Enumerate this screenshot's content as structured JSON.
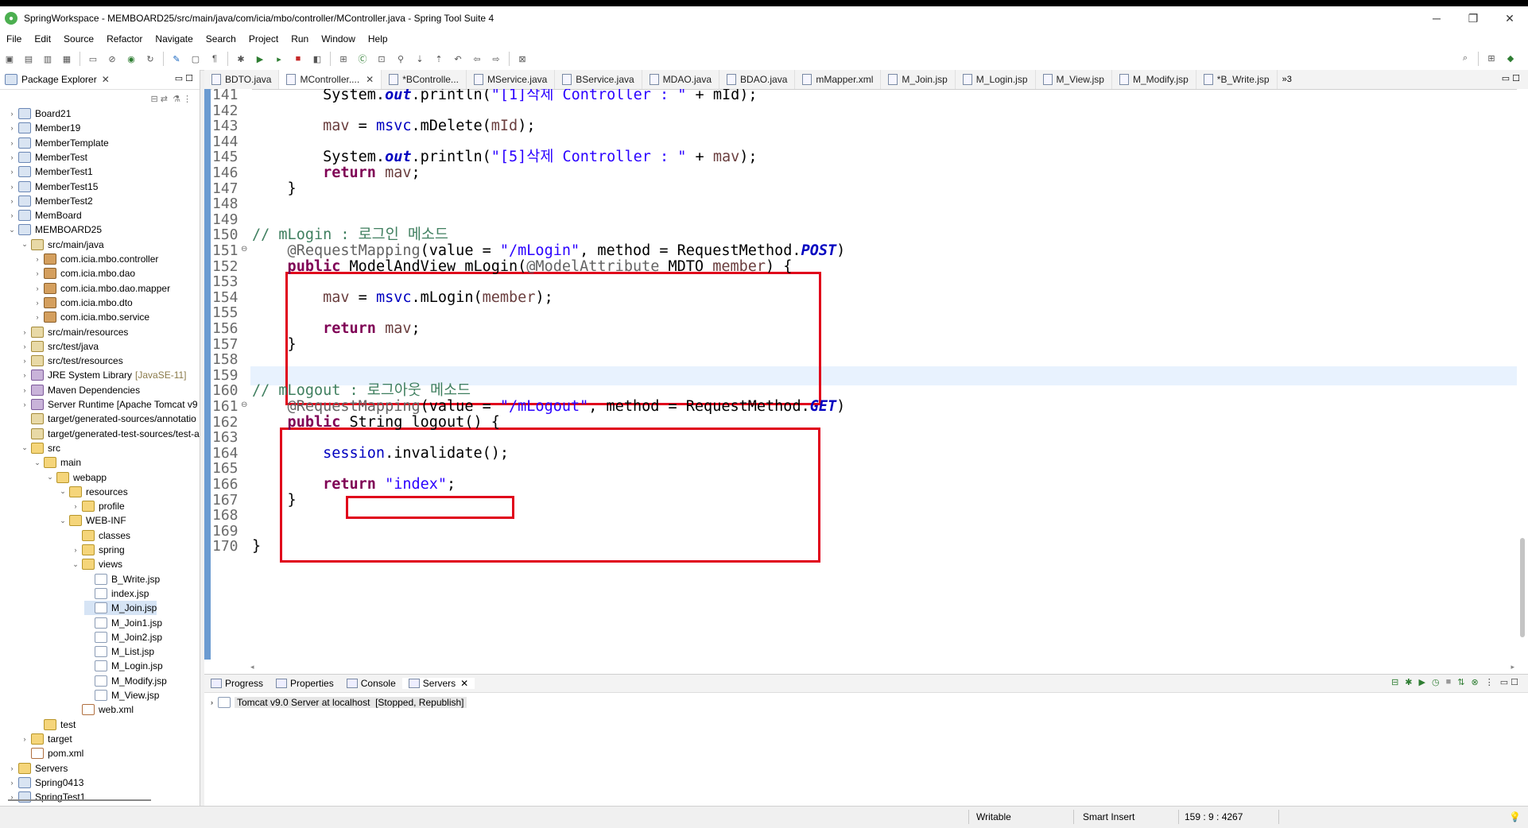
{
  "window": {
    "title": "SpringWorkspace - MEMBOARD25/src/main/java/com/icia/mbo/controller/MController.java - Spring Tool Suite 4",
    "controls": [
      "─",
      "❐",
      "✕"
    ]
  },
  "menu": [
    "File",
    "Edit",
    "Source",
    "Refactor",
    "Navigate",
    "Search",
    "Project",
    "Run",
    "Window",
    "Help"
  ],
  "package_explorer": {
    "title": "Package Explorer",
    "tree": [
      {
        "label": "Board21",
        "icon": "project",
        "tw": "›",
        "indent": 0
      },
      {
        "label": "Member19",
        "icon": "project",
        "tw": "›",
        "indent": 0
      },
      {
        "label": "MemberTemplate",
        "icon": "project",
        "tw": "›",
        "indent": 0
      },
      {
        "label": "MemberTest",
        "icon": "project",
        "tw": "›",
        "indent": 0
      },
      {
        "label": "MemberTest1",
        "icon": "project",
        "tw": "›",
        "indent": 0
      },
      {
        "label": "MemberTest15",
        "icon": "project",
        "tw": "›",
        "indent": 0
      },
      {
        "label": "MemberTest2",
        "icon": "project",
        "tw": "›",
        "indent": 0
      },
      {
        "label": "MemBoard",
        "icon": "project",
        "tw": "›",
        "indent": 0
      },
      {
        "label": "MEMBOARD25",
        "icon": "project",
        "tw": "⌄",
        "indent": 0
      },
      {
        "label": "src/main/java",
        "icon": "srcfolder",
        "tw": "⌄",
        "indent": 1
      },
      {
        "label": "com.icia.mbo.controller",
        "icon": "package",
        "tw": "›",
        "indent": 2
      },
      {
        "label": "com.icia.mbo.dao",
        "icon": "package",
        "tw": "›",
        "indent": 2
      },
      {
        "label": "com.icia.mbo.dao.mapper",
        "icon": "package",
        "tw": "›",
        "indent": 2
      },
      {
        "label": "com.icia.mbo.dto",
        "icon": "package",
        "tw": "›",
        "indent": 2
      },
      {
        "label": "com.icia.mbo.service",
        "icon": "package",
        "tw": "›",
        "indent": 2
      },
      {
        "label": "src/main/resources",
        "icon": "srcfolder",
        "tw": "›",
        "indent": 1
      },
      {
        "label": "src/test/java",
        "icon": "srcfolder",
        "tw": "›",
        "indent": 1
      },
      {
        "label": "src/test/resources",
        "icon": "srcfolder",
        "tw": "›",
        "indent": 1
      },
      {
        "label": "JRE System Library",
        "suffix": "[JavaSE-11]",
        "icon": "library",
        "tw": "›",
        "indent": 1
      },
      {
        "label": "Maven Dependencies",
        "icon": "library",
        "tw": "›",
        "indent": 1
      },
      {
        "label": "Server Runtime [Apache Tomcat v9",
        "icon": "library",
        "tw": "›",
        "indent": 1
      },
      {
        "label": "target/generated-sources/annotatio",
        "icon": "srcfolder",
        "tw": "",
        "indent": 1
      },
      {
        "label": "target/generated-test-sources/test-a",
        "icon": "srcfolder",
        "tw": "",
        "indent": 1
      },
      {
        "label": "src",
        "icon": "folder",
        "tw": "⌄",
        "indent": 1
      },
      {
        "label": "main",
        "icon": "folder",
        "tw": "⌄",
        "indent": 2
      },
      {
        "label": "webapp",
        "icon": "folder",
        "tw": "⌄",
        "indent": 3
      },
      {
        "label": "resources",
        "icon": "folder",
        "tw": "⌄",
        "indent": 4
      },
      {
        "label": "profile",
        "icon": "folder",
        "tw": "›",
        "indent": 5
      },
      {
        "label": "WEB-INF",
        "icon": "folder",
        "tw": "⌄",
        "indent": 4
      },
      {
        "label": "classes",
        "icon": "folder",
        "tw": "",
        "indent": 5
      },
      {
        "label": "spring",
        "icon": "folder",
        "tw": "›",
        "indent": 5
      },
      {
        "label": "views",
        "icon": "folder",
        "tw": "⌄",
        "indent": 5
      },
      {
        "label": "B_Write.jsp",
        "icon": "file",
        "tw": "",
        "indent": 6
      },
      {
        "label": "index.jsp",
        "icon": "file",
        "tw": "",
        "indent": 6
      },
      {
        "label": "M_Join.jsp",
        "icon": "file",
        "tw": "",
        "indent": 6,
        "selected": true
      },
      {
        "label": "M_Join1.jsp",
        "icon": "file",
        "tw": "",
        "indent": 6
      },
      {
        "label": "M_Join2.jsp",
        "icon": "file",
        "tw": "",
        "indent": 6
      },
      {
        "label": "M_List.jsp",
        "icon": "file",
        "tw": "",
        "indent": 6
      },
      {
        "label": "M_Login.jsp",
        "icon": "file",
        "tw": "",
        "indent": 6
      },
      {
        "label": "M_Modify.jsp",
        "icon": "file",
        "tw": "",
        "indent": 6
      },
      {
        "label": "M_View.jsp",
        "icon": "file",
        "tw": "",
        "indent": 6
      },
      {
        "label": "web.xml",
        "icon": "xml",
        "tw": "",
        "indent": 5
      },
      {
        "label": "test",
        "icon": "folder",
        "tw": "",
        "indent": 2
      },
      {
        "label": "target",
        "icon": "folder",
        "tw": "›",
        "indent": 1
      },
      {
        "label": "pom.xml",
        "icon": "xml",
        "tw": "",
        "indent": 1
      },
      {
        "label": "Servers",
        "icon": "folder",
        "tw": "›",
        "indent": 0
      },
      {
        "label": "Spring0413",
        "icon": "project",
        "tw": "›",
        "indent": 0
      },
      {
        "label": "SpringTest1",
        "icon": "project",
        "tw": "›",
        "indent": 0
      }
    ]
  },
  "editor": {
    "tabs": [
      {
        "label": "BDTO.java"
      },
      {
        "label": "MController....",
        "active": true,
        "closable": true
      },
      {
        "label": "*BControlle..."
      },
      {
        "label": "MService.java"
      },
      {
        "label": "BService.java"
      },
      {
        "label": "MDAO.java"
      },
      {
        "label": "BDAO.java"
      },
      {
        "label": "mMapper.xml"
      },
      {
        "label": "M_Join.jsp"
      },
      {
        "label": "M_Login.jsp"
      },
      {
        "label": "M_View.jsp"
      },
      {
        "label": "M_Modify.jsp"
      },
      {
        "label": "*B_Write.jsp"
      }
    ],
    "more_tabs": "»3",
    "current_line": 159,
    "lines": [
      {
        "n": "141",
        "parts": [
          [
            "",
            "        System."
          ],
          [
            "fi",
            "out"
          ],
          [
            "",
            ".println("
          ],
          [
            "st",
            "\"[1]삭제 Controller : \""
          ],
          [
            "",
            " + mId);"
          ]
        ]
      },
      {
        "n": "142",
        "parts": []
      },
      {
        "n": "143",
        "parts": [
          [
            "var",
            "        mav"
          ],
          [
            "",
            " = "
          ],
          [
            "fld",
            "msvc"
          ],
          [
            "",
            ".mDelete("
          ],
          [
            "var",
            "mId"
          ],
          [
            "",
            ");"
          ]
        ]
      },
      {
        "n": "144",
        "parts": []
      },
      {
        "n": "145",
        "parts": [
          [
            "",
            "        System."
          ],
          [
            "fi",
            "out"
          ],
          [
            "",
            ".println("
          ],
          [
            "st",
            "\"[5]삭제 Controller : \""
          ],
          [
            "",
            " + "
          ],
          [
            "var",
            "mav"
          ],
          [
            "",
            ");"
          ]
        ]
      },
      {
        "n": "146",
        "parts": [
          [
            "kw",
            "        return"
          ],
          [
            "",
            " "
          ],
          [
            "var",
            "mav"
          ],
          [
            "",
            ";"
          ]
        ]
      },
      {
        "n": "147",
        "parts": [
          [
            "",
            "    }"
          ]
        ]
      },
      {
        "n": "148",
        "parts": []
      },
      {
        "n": "149",
        "parts": []
      },
      {
        "n": "150",
        "parts": [
          [
            "cm",
            "// mLogin : 로그인 메소드"
          ]
        ]
      },
      {
        "n": "151",
        "fold": true,
        "parts": [
          [
            "an",
            "    @RequestMapping"
          ],
          [
            "",
            "(value = "
          ],
          [
            "st",
            "\"/mLogin\""
          ],
          [
            "",
            ", method = RequestMethod."
          ],
          [
            "fi",
            "POST"
          ],
          [
            "",
            ")"
          ]
        ]
      },
      {
        "n": "152",
        "parts": [
          [
            "kw",
            "    public"
          ],
          [
            "",
            " ModelAndView mLogin("
          ],
          [
            "an",
            "@ModelAttribute"
          ],
          [
            "",
            " MDTO "
          ],
          [
            "var",
            "member"
          ],
          [
            "",
            ") {"
          ]
        ]
      },
      {
        "n": "153",
        "parts": []
      },
      {
        "n": "154",
        "parts": [
          [
            "var",
            "        mav"
          ],
          [
            "",
            " = "
          ],
          [
            "fld",
            "msvc"
          ],
          [
            "",
            ".mLogin("
          ],
          [
            "var",
            "member"
          ],
          [
            "",
            ");"
          ]
        ]
      },
      {
        "n": "155",
        "parts": []
      },
      {
        "n": "156",
        "parts": [
          [
            "kw",
            "        return"
          ],
          [
            "",
            " "
          ],
          [
            "var",
            "mav"
          ],
          [
            "",
            ";"
          ]
        ]
      },
      {
        "n": "157",
        "parts": [
          [
            "",
            "    }"
          ]
        ]
      },
      {
        "n": "158",
        "parts": []
      },
      {
        "n": "159",
        "parts": []
      },
      {
        "n": "160",
        "parts": [
          [
            "cm",
            "// mLogout : 로그아웃 메소드"
          ]
        ]
      },
      {
        "n": "161",
        "fold": true,
        "parts": [
          [
            "an",
            "    @RequestMapping"
          ],
          [
            "",
            "(value = "
          ],
          [
            "st",
            "\"/mLogout\""
          ],
          [
            "",
            ", method = RequestMethod."
          ],
          [
            "fi",
            "GET"
          ],
          [
            "",
            ")"
          ]
        ]
      },
      {
        "n": "162",
        "parts": [
          [
            "kw",
            "    public"
          ],
          [
            "",
            " String logout() {"
          ]
        ]
      },
      {
        "n": "163",
        "parts": []
      },
      {
        "n": "164",
        "parts": [
          [
            "fld",
            "        session"
          ],
          [
            "",
            ".invalidate();"
          ]
        ]
      },
      {
        "n": "165",
        "parts": []
      },
      {
        "n": "166",
        "parts": [
          [
            "kw",
            "        return"
          ],
          [
            "",
            " "
          ],
          [
            "st",
            "\"index\""
          ],
          [
            "",
            ";"
          ]
        ]
      },
      {
        "n": "167",
        "parts": [
          [
            "",
            "    }"
          ]
        ]
      },
      {
        "n": "168",
        "parts": []
      },
      {
        "n": "169",
        "parts": []
      },
      {
        "n": "170",
        "parts": [
          [
            "",
            "}"
          ]
        ]
      }
    ]
  },
  "bottom_panel": {
    "tabs": [
      "Progress",
      "Properties",
      "Console",
      "Servers"
    ],
    "active_tab": "Servers",
    "server_name": "Tomcat v9.0 Server at localhost",
    "server_state": "[Stopped, Republish]"
  },
  "status_bar": {
    "mode": "Writable",
    "insert": "Smart Insert",
    "position": "159 : 9 : 4267"
  }
}
